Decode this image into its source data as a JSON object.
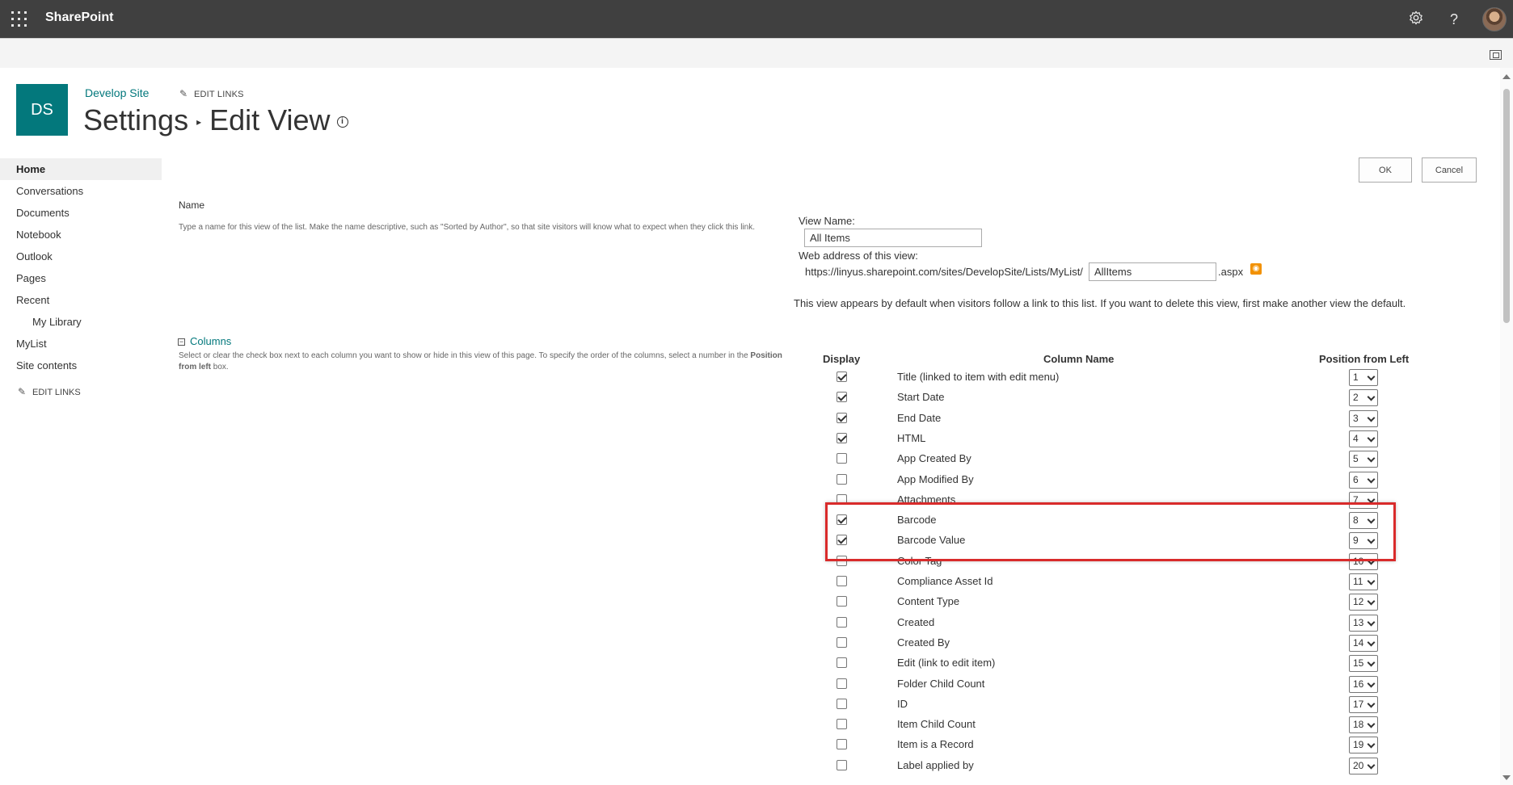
{
  "suitebar": {
    "brand": "SharePoint",
    "settings_icon": "gear-icon",
    "help_icon": "?",
    "app_launcher_icon": "waffle-icon"
  },
  "site": {
    "logo_initials": "DS",
    "title": "Develop Site",
    "edit_links": "EDIT LINKS",
    "breadcrumb_parent": "Settings",
    "breadcrumb_current": "Edit View"
  },
  "leftnav": {
    "items": [
      {
        "label": "Home"
      },
      {
        "label": "Conversations"
      },
      {
        "label": "Documents"
      },
      {
        "label": "Notebook"
      },
      {
        "label": "Outlook"
      },
      {
        "label": "Pages"
      },
      {
        "label": "Recent"
      },
      {
        "label": "My Library"
      },
      {
        "label": "MyList"
      },
      {
        "label": "Site contents"
      }
    ],
    "edit_links": "EDIT LINKS"
  },
  "toolbar": {
    "ok_label": "OK",
    "cancel_label": "Cancel"
  },
  "name_section": {
    "heading": "Name",
    "description": "Type a name for this view of the list. Make the name descriptive, such as \"Sorted by Author\", so that site visitors will know what to expect when they click this link.",
    "view_name_label": "View Name:",
    "view_name_value": "All Items",
    "web_address_label": "Web address of this view:",
    "url_prefix": "https://linyus.sharepoint.com/sites/DevelopSite/Lists/MyList/",
    "url_page_value": "AllItems",
    "url_suffix": ".aspx",
    "default_note": "This view appears by default when visitors follow a link to this list. If you want to delete this view, first make another view the default."
  },
  "columns_section": {
    "toggle_symbol": "−",
    "heading": "Columns",
    "description_part1": "Select or clear the check box next to each column you want to show or hide in this view of this page. To specify the order of the columns, select a number in the",
    "description_bold": "Position from left",
    "description_part2": "box.",
    "headers": {
      "display": "Display",
      "column_name": "Column Name",
      "position": "Position from Left"
    },
    "rows": [
      {
        "name": "Title (linked to item with edit menu)",
        "checked": true,
        "pos": "1"
      },
      {
        "name": "Start Date",
        "checked": true,
        "pos": "2"
      },
      {
        "name": "End Date",
        "checked": true,
        "pos": "3"
      },
      {
        "name": "HTML",
        "checked": true,
        "pos": "4"
      },
      {
        "name": "App Created By",
        "checked": false,
        "pos": "5"
      },
      {
        "name": "App Modified By",
        "checked": false,
        "pos": "6"
      },
      {
        "name": "Attachments",
        "checked": false,
        "pos": "7"
      },
      {
        "name": "Barcode",
        "checked": true,
        "pos": "8"
      },
      {
        "name": "Barcode Value",
        "checked": true,
        "pos": "9"
      },
      {
        "name": "Color Tag",
        "checked": false,
        "pos": "10"
      },
      {
        "name": "Compliance Asset Id",
        "checked": false,
        "pos": "11"
      },
      {
        "name": "Content Type",
        "checked": false,
        "pos": "12"
      },
      {
        "name": "Created",
        "checked": false,
        "pos": "13"
      },
      {
        "name": "Created By",
        "checked": false,
        "pos": "14"
      },
      {
        "name": "Edit (link to edit item)",
        "checked": false,
        "pos": "15"
      },
      {
        "name": "Folder Child Count",
        "checked": false,
        "pos": "16"
      },
      {
        "name": "ID",
        "checked": false,
        "pos": "17"
      },
      {
        "name": "Item Child Count",
        "checked": false,
        "pos": "18"
      },
      {
        "name": "Item is a Record",
        "checked": false,
        "pos": "19"
      },
      {
        "name": "Label applied by",
        "checked": false,
        "pos": "20"
      }
    ]
  },
  "colors": {
    "suitebar": "#404040",
    "accent": "#03787c",
    "highlight": "#d92b2b",
    "rss": "#f29101"
  }
}
